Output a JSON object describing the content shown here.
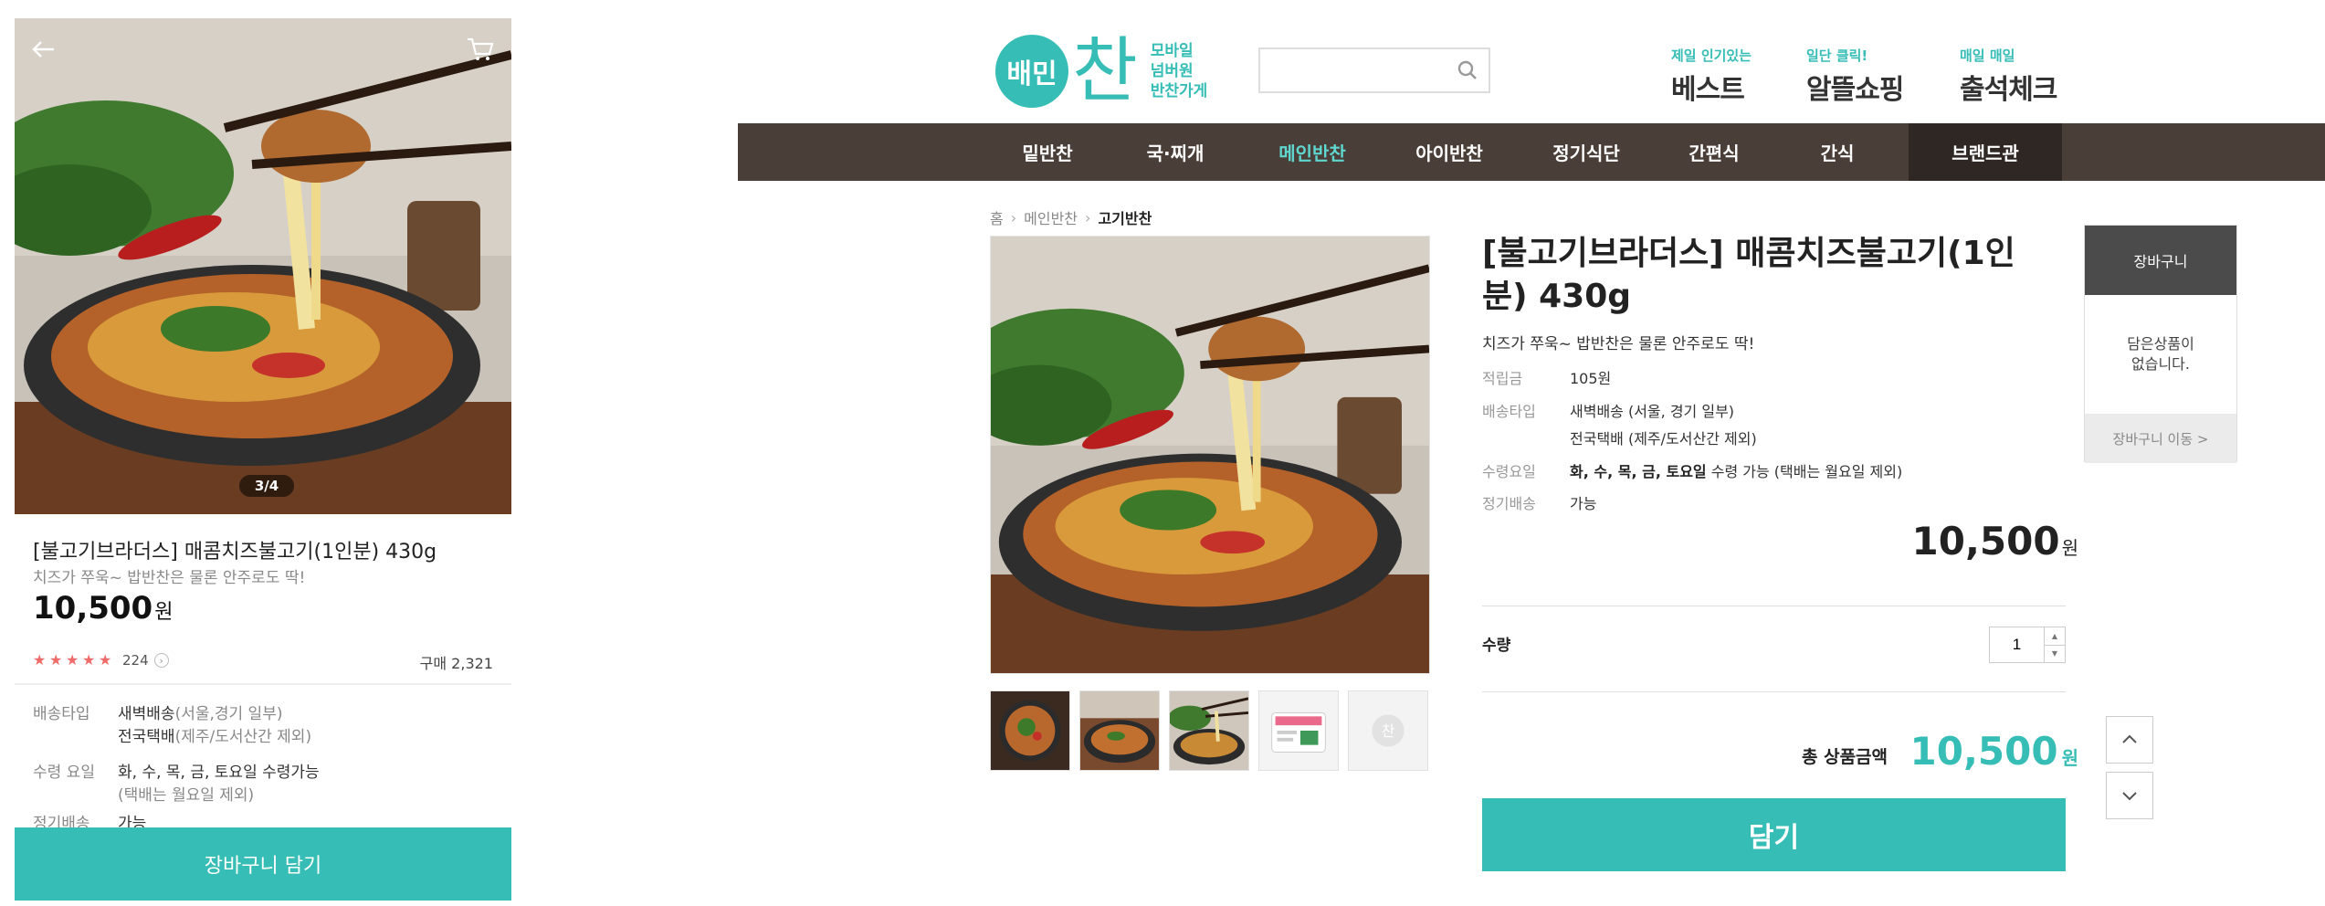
{
  "mobile": {
    "back_icon": "arrow-left-icon",
    "cart_icon": "cart-icon",
    "pager": "3/4",
    "title": "[불고기브라더스] 매콤치즈불고기(1인분) 430g",
    "subtitle": "치즈가 쭈욱~ 밥반찬은 물론 안주로도 딱!",
    "price": "10,500",
    "price_unit": "원",
    "review_count": "224",
    "purchase_count": "구매 2,321",
    "delivery_label": "배송타입",
    "delivery_line1_strong": "새벽배송",
    "delivery_line1_note": "(서울,경기 일부)",
    "delivery_line2_strong": "전국택배",
    "delivery_line2_note": "(제주/도서산간 제외)",
    "receive_label": "수령 요일",
    "receive_line1": "화, 수, 목, 금, 토요일 수령가능",
    "receive_line2": "(택배는 월요일 제외)",
    "regular_label": "정기배송",
    "regular_value": "가능",
    "cart_button": "장바구니 담기"
  },
  "header": {
    "logo_circle": "배민",
    "logo_chan": "찬",
    "logo_lines": [
      "모바일",
      "넘버원",
      "반찬가게"
    ],
    "search_placeholder": "",
    "promos": [
      {
        "small": "제일 인기있는",
        "big": "베스트"
      },
      {
        "small": "일단 클릭!",
        "big": "알뜰쇼핑"
      },
      {
        "small": "매일 매일",
        "big": "출석체크"
      }
    ]
  },
  "nav": {
    "items": [
      "밑반찬",
      "국·찌개",
      "메인반찬",
      "아이반찬",
      "정기식단",
      "간편식",
      "간식",
      "브랜드관"
    ],
    "active": "메인반찬"
  },
  "breadcrumb": {
    "home": "홈",
    "level1": "메인반찬",
    "current": "고기반찬"
  },
  "product": {
    "title": "[불고기브라더스] 매콤치즈불고기(1인분) 430g",
    "subtitle": "치즈가 쭈욱~ 밥반찬은 물론 안주로도 딱!",
    "points_label": "적립금",
    "points_value": "105원",
    "delivery_label": "배송타입",
    "delivery_line1": "새벽배송 (서울, 경기 일부)",
    "delivery_line2": "전국택배 (제주/도서산간 제외)",
    "receive_label": "수령요일",
    "receive_days": "화, 수, 목, 금, 토요일",
    "receive_rest": " 수령 가능 (택배는 월요일 제외)",
    "regular_label": "정기배송",
    "regular_value": "가능",
    "price": "10,500",
    "price_unit": "원",
    "qty_label": "수량",
    "qty_value": "1",
    "total_label": "총 상품금액",
    "total_value": "10,500",
    "total_unit": "원",
    "add_button": "담기"
  },
  "cart_widget": {
    "title": "장바구니",
    "empty_line1": "담은상품이",
    "empty_line2": "없습니다.",
    "go_button": "장바구니 이동 >"
  },
  "colors": {
    "accent": "#36bdb6",
    "nav_bg": "#4a3f38",
    "nav_active": "#5fd6cf",
    "brand_bg": "#2f2723",
    "star": "#f06a6a"
  }
}
